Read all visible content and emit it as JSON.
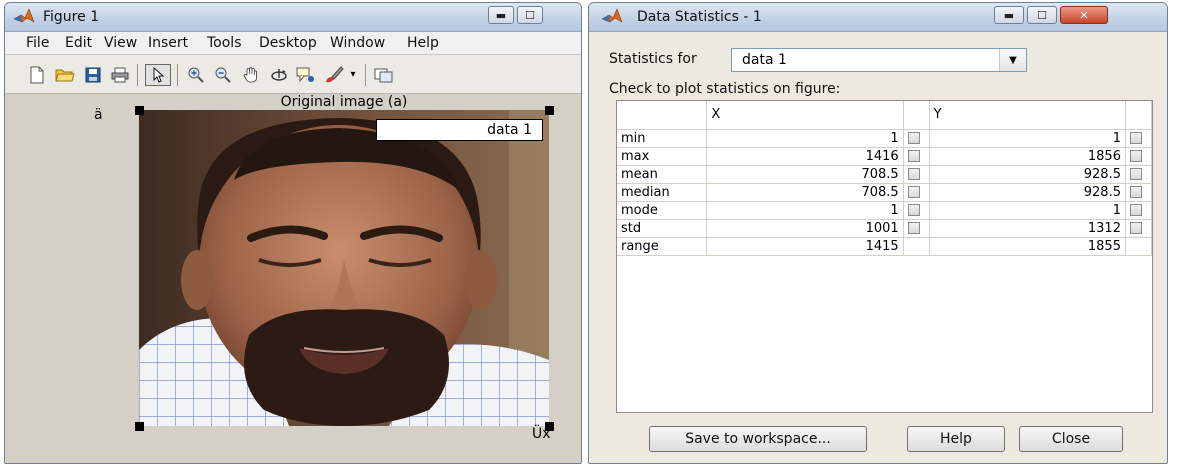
{
  "figure": {
    "title": "Figure 1",
    "menu": [
      "File",
      "Edit",
      "View",
      "Insert",
      "Tools",
      "Desktop",
      "Window",
      "Help"
    ],
    "toolbar_icons": [
      "new-file-icon",
      "open-folder-icon",
      "save-icon",
      "print-icon",
      "pointer-icon",
      "zoom-in-icon",
      "zoom-out-icon",
      "pan-hand-icon",
      "rotate-3d-icon",
      "data-cursor-icon",
      "brush-icon",
      "dropdown-arrow-icon",
      "link-plot-icon"
    ],
    "plot_title": "Original image (a)",
    "legend": "data 1",
    "y_label": "ä",
    "x_label": "Üx"
  },
  "stats": {
    "title": "Data Statistics - 1",
    "statistics_for_label": "Statistics for",
    "selected_data": "data 1",
    "check_label": "Check to plot statistics on figure:",
    "columns": [
      "X",
      "Y"
    ],
    "rows": [
      {
        "label": "min",
        "x": "1",
        "y": "1"
      },
      {
        "label": "max",
        "x": "1416",
        "y": "1856"
      },
      {
        "label": "mean",
        "x": "708.5",
        "y": "928.5"
      },
      {
        "label": "median",
        "x": "708.5",
        "y": "928.5"
      },
      {
        "label": "mode",
        "x": "1",
        "y": "1"
      },
      {
        "label": "std",
        "x": "1001",
        "y": "1312"
      },
      {
        "label": "range",
        "x": "1415",
        "y": "1855"
      }
    ],
    "buttons": {
      "save": "Save to workspace...",
      "help": "Help",
      "close": "Close"
    }
  },
  "colors": {
    "titlebar": "#c3d3e6",
    "figure_bg": "#d4d0c8",
    "dialog_bg": "#ece9e0",
    "close_button": "#c9442c"
  }
}
